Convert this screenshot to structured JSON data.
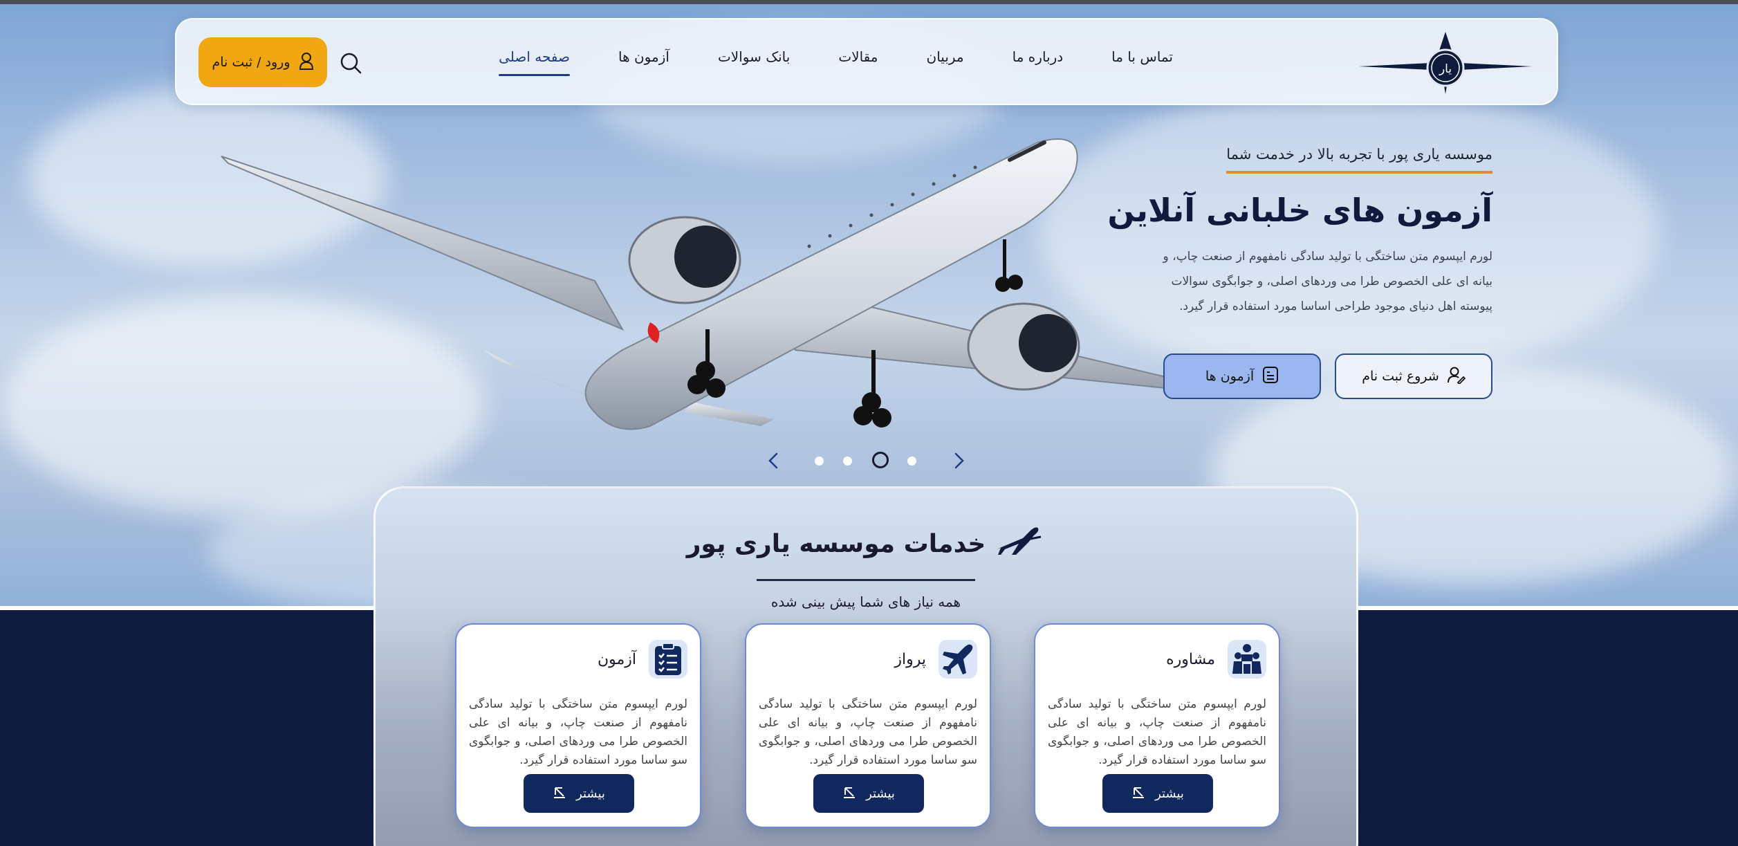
{
  "nav": {
    "logo_text": "یار",
    "menu": [
      {
        "label": "صفحه اصلی",
        "active": true
      },
      {
        "label": "آزمون ها",
        "active": false
      },
      {
        "label": "بانک سوالات",
        "active": false
      },
      {
        "label": "مقالات",
        "active": false
      },
      {
        "label": "مربیان",
        "active": false
      },
      {
        "label": "درباره ما",
        "active": false
      },
      {
        "label": "تماس با ما",
        "active": false
      }
    ],
    "search_icon": "search-icon",
    "login_label": "ورود / ثبت نام",
    "login_color": "#f0a712"
  },
  "hero": {
    "tagline": "موسسه یاری پور با تجربه بالا در خدمت شما",
    "title": "آزمون های خلبانی آنلاین",
    "description": "لورم ایپسوم متن ساختگی با تولید سادگی نامفهوم از صنعت چاپ، و بیانه ای علی الخصوص طرا می وردهای اصلی، و جوابگوی سوالات پیوسته اهل دنیای موجود طراحی اساسا مورد استفاده قرار گیرد.",
    "register_button": "شروع ثبت نام",
    "exams_button": "آزمون ها",
    "accent_color": "#e6892f"
  },
  "slider": {
    "total": 4,
    "active_index": 2
  },
  "services": {
    "title": "خدمات موسسه یاری پور",
    "subtitle": "همه نیاز های شما پیش بینی شده",
    "cards": [
      {
        "title": "مشاوره",
        "icon": "consultation-icon",
        "text": "لورم ایپسوم متن ساختگی با تولید سادگی نامفهوم از صنعت چاپ، و بیانه ای علی الخصوص طرا می وردهای اصلی، و جوابگوی سو ساسا مورد استفاده قرار گیرد.",
        "button": "بیشتر"
      },
      {
        "title": "پرواز",
        "icon": "airplane-icon",
        "text": "لورم ایپسوم متن ساختگی با تولید سادگی نامفهوم از صنعت چاپ، و بیانه ای علی الخصوص طرا می وردهای اصلی، و جوابگوی سو ساسا مورد استفاده قرار گیرد.",
        "button": "بیشتر"
      },
      {
        "title": "آزمون",
        "icon": "clipboard-icon",
        "text": "لورم ایپسوم متن ساختگی با تولید سادگی نامفهوم از صنعت چاپ، و بیانه ای علی الخصوص طرا می وردهای اصلی، و جوابگوی سو ساسا مورد استفاده قرار گیرد.",
        "button": "بیشتر"
      }
    ]
  },
  "colors": {
    "navy": "#0f1b3d",
    "button_dark": "#10285e",
    "card_border": "#6e8ad6"
  }
}
